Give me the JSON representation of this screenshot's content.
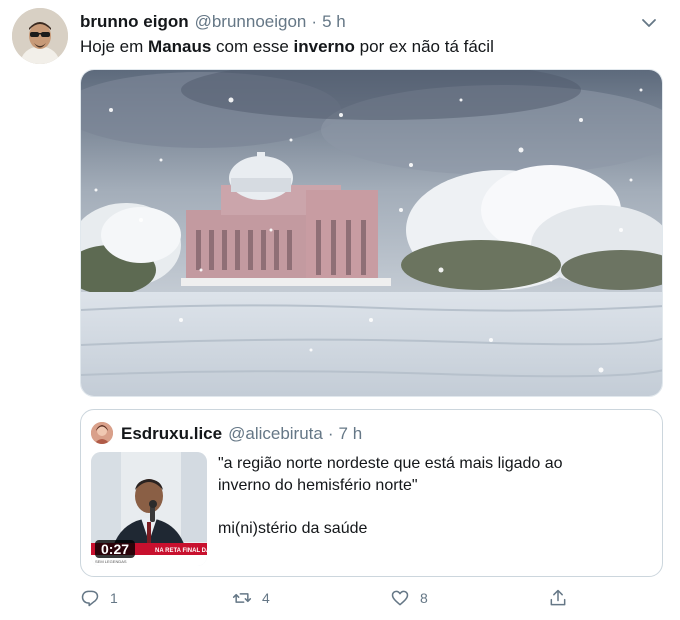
{
  "author": {
    "name": "brunno eigon",
    "handle": "@brunnoeigon",
    "separator": "·",
    "time": "5 h"
  },
  "tweet": {
    "prefix": "Hoje em ",
    "bold1": "Manaus",
    "middle": " com esse ",
    "bold2": "inverno",
    "suffix": " por ex não tá fácil"
  },
  "quote": {
    "name": "Esdruxu.lice",
    "handle": "@alicebiruta",
    "separator": "·",
    "time": "7 h",
    "line1": "\"a região norte nordeste que está mais ligado ao",
    "line2": "inverno do hemisfério norte\"",
    "line3": "mi(ni)stério da saúde",
    "video_duration": "0:27"
  },
  "actions": {
    "reply_count": "1",
    "retweet_count": "4",
    "like_count": "8"
  },
  "colors": {
    "secondary_text": "#657786",
    "border": "#ccd6dd",
    "text": "#14171a"
  },
  "icons": [
    "chevron-down-icon",
    "reply-icon",
    "retweet-icon",
    "heart-icon",
    "share-icon"
  ]
}
